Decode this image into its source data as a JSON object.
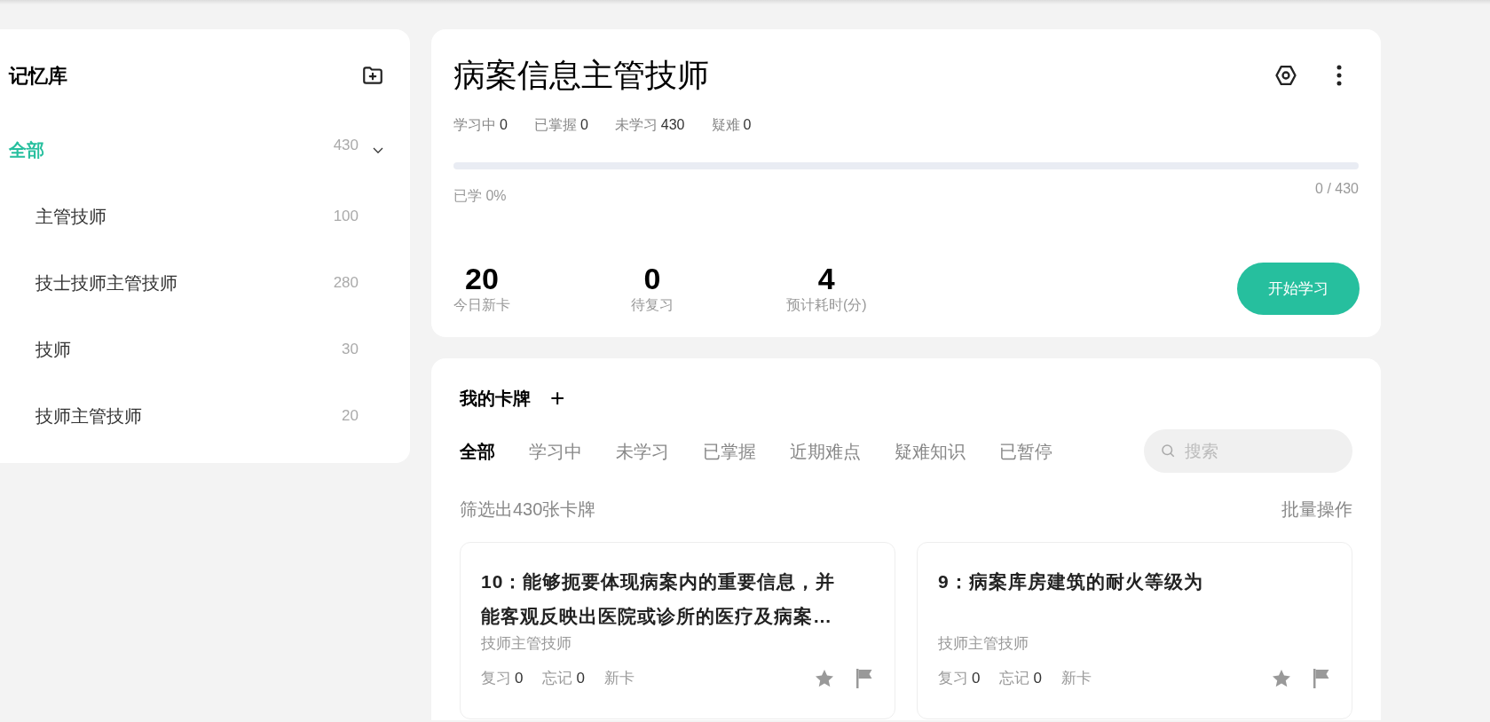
{
  "sidebar": {
    "title": "记忆库",
    "tree": [
      {
        "label": "全部",
        "count": "430",
        "selected": true,
        "expanded": true,
        "children": [
          {
            "label": "主管技师",
            "count": "100",
            "selected": false
          },
          {
            "label": "技士技师主管技师",
            "count": "280",
            "selected": false
          },
          {
            "label": "技师",
            "count": "30",
            "selected": false
          },
          {
            "label": "技师主管技师",
            "count": "20",
            "selected": false
          }
        ]
      }
    ]
  },
  "deck": {
    "title": "病案信息主管技师",
    "stats": [
      {
        "label": "学习中",
        "value": "0"
      },
      {
        "label": "已掌握",
        "value": "0"
      },
      {
        "label": "未学习",
        "value": "430"
      },
      {
        "label": "疑难",
        "value": "0"
      }
    ],
    "progress": {
      "level": 0,
      "label": "已学 0%",
      "reading": "0 / 430"
    },
    "summary": [
      {
        "value": "20",
        "label": "今日新卡"
      },
      {
        "value": "0",
        "label": "待复习"
      },
      {
        "value": "4",
        "label": "预计耗时(分)"
      }
    ],
    "start_button": "开始学习"
  },
  "cards_panel": {
    "title": "我的卡牌",
    "add": "+",
    "tabs": [
      {
        "label": "全部",
        "selected": true
      },
      {
        "label": "学习中",
        "selected": false
      },
      {
        "label": "未学习",
        "selected": false
      },
      {
        "label": "已掌握",
        "selected": false
      },
      {
        "label": "近期难点",
        "selected": false
      },
      {
        "label": "疑难知识",
        "selected": false
      },
      {
        "label": "已暂停",
        "selected": false
      }
    ],
    "search": {
      "placeholder": "搜索"
    },
    "filter_text": "筛选出430张卡牌",
    "batch": "批量操作",
    "cards": [
      {
        "title": "10：能够扼要体现病案内的重要信息，并能客观反映出医院或诊所的医疗及病案…",
        "category": "技师主管技师",
        "review": "复习",
        "review_count": "0",
        "forget": "忘记",
        "forget_count": "0",
        "status": "新卡"
      },
      {
        "title": "9：病案库房建筑的耐火等级为",
        "category": "技师主管技师",
        "review": "复习",
        "review_count": "0",
        "forget": "忘记",
        "forget_count": "0",
        "status": "新卡"
      }
    ]
  }
}
